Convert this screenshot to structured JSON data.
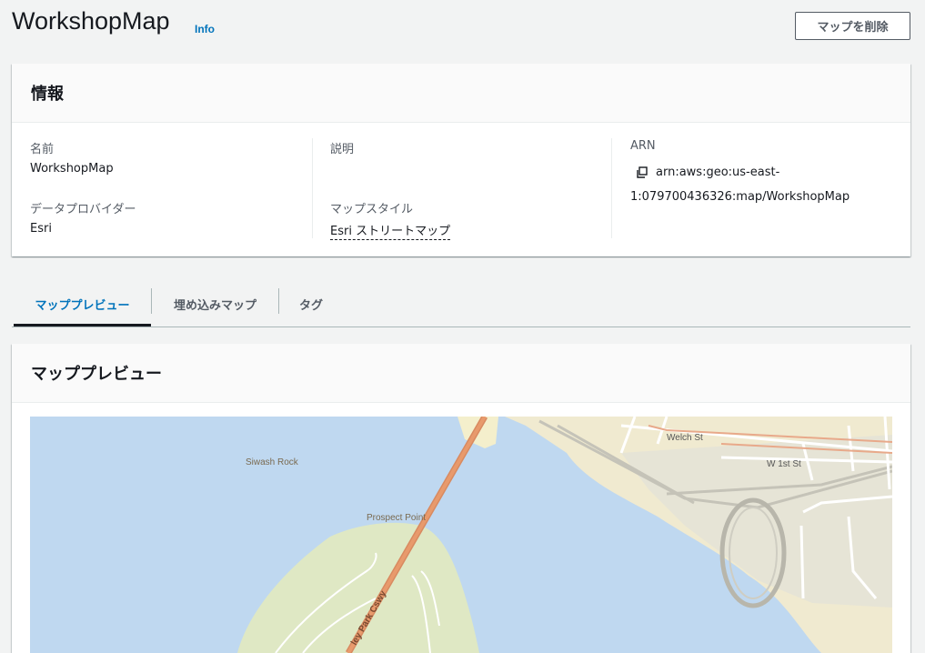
{
  "header": {
    "title": "WorkshopMap",
    "info_label": "Info",
    "delete_label": "マップを削除"
  },
  "info_card": {
    "title": "情報",
    "name_label": "名前",
    "name_value": "WorkshopMap",
    "provider_label": "データプロバイダー",
    "provider_value": "Esri",
    "description_label": "説明",
    "style_label": "マップスタイル",
    "style_value": "Esri ストリートマップ",
    "arn_label": "ARN",
    "arn_line1": "arn:aws:geo:us-east-",
    "arn_line2": "1:079700436326:map/WorkshopMap"
  },
  "tabs": [
    {
      "label": "マッププレビュー",
      "active": true
    },
    {
      "label": "埋め込みマップ",
      "active": false
    },
    {
      "label": "タグ",
      "active": false
    }
  ],
  "preview": {
    "title": "マッププレビュー",
    "labels": {
      "siwash_rock": "Siwash Rock",
      "prospect_point": "Prospect Point",
      "welch_st": "Welch St",
      "w1st_st": "W 1st St",
      "causeway": "ley Park Cswy"
    }
  },
  "colors": {
    "accent": "#0073bb",
    "water": "#bfd8f0",
    "park": "#dfe8c4",
    "land": "#f0ead0",
    "bridge": "#e89a6c"
  },
  "icons": {
    "copy": "copy-icon"
  }
}
